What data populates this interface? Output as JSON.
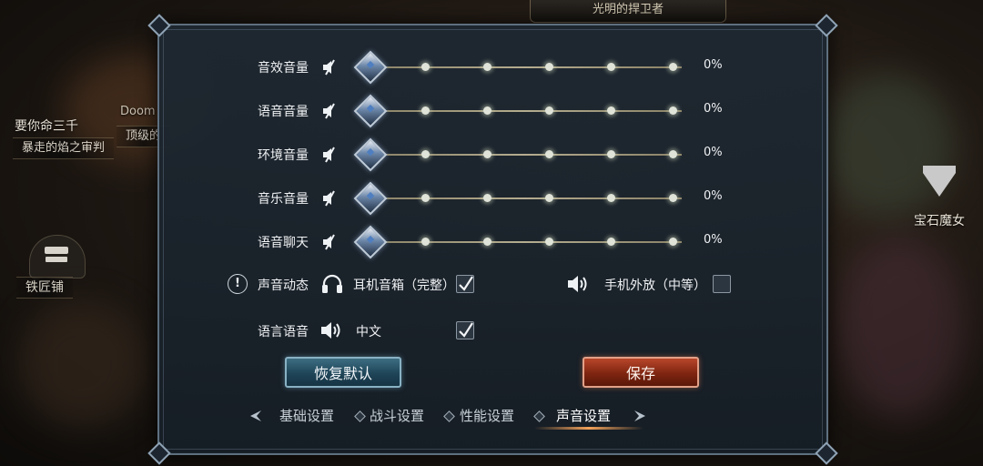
{
  "background": {
    "top_banner": "光明的捍卫者",
    "left_player": "要你命三千",
    "left_player_title": "暴走的焰之审判",
    "left_player2": "Doom",
    "left_player2_title": "顶级的",
    "blacksmith": "铁匠铺",
    "gem_witch": "宝石魔女"
  },
  "volume_rows": [
    {
      "label": "音效音量",
      "value": "0%",
      "level": 0
    },
    {
      "label": "语音音量",
      "value": "0%",
      "level": 0
    },
    {
      "label": "环境音量",
      "value": "0%",
      "level": 0
    },
    {
      "label": "音乐音量",
      "value": "0%",
      "level": 0
    },
    {
      "label": "语音聊天",
      "value": "0%",
      "level": 0
    }
  ],
  "sound_dynamics": {
    "label": "声音动态",
    "info_icon": "!",
    "headphone_option": {
      "label": "耳机音箱（完整）",
      "icon": "headphone-icon",
      "checked": true
    },
    "phone_option": {
      "label": "手机外放（中等）",
      "icon": "speaker-icon",
      "checked": false
    }
  },
  "voice_language": {
    "label": "语言语音",
    "icon": "speaker-icon",
    "value": "中文",
    "checked": true
  },
  "buttons": {
    "reset": "恢复默认",
    "save": "保存"
  },
  "tabs": [
    {
      "label": "基础设置",
      "active": false
    },
    {
      "label": "战斗设置",
      "active": false
    },
    {
      "label": "性能设置",
      "active": false
    },
    {
      "label": "声音设置",
      "active": true
    }
  ],
  "colors": {
    "accent_tab": "#f3a25a",
    "reset_button": "#1f4558",
    "save_button": "#7e2511"
  }
}
